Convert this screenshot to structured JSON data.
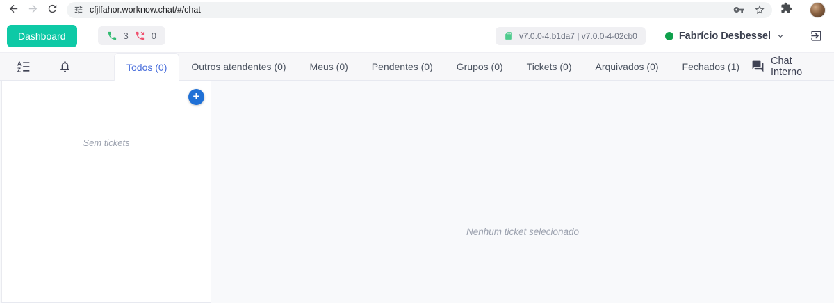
{
  "browser": {
    "url": "cfjlfahor.worknow.chat/#/chat"
  },
  "header": {
    "dashboard_button": "Dashboard",
    "calls": {
      "answered": "3",
      "missed": "0"
    },
    "version": "v7.0.0-4.b1da7 | v7.0.0-4-02cb0",
    "user": {
      "name": "Fabrício Desbessel",
      "status": "online"
    }
  },
  "tab_bar": {
    "tabs": [
      {
        "label": "Todos (0)",
        "active": true
      },
      {
        "label": "Outros atendentes (0)",
        "active": false
      },
      {
        "label": "Meus (0)",
        "active": false
      },
      {
        "label": "Pendentes (0)",
        "active": false
      },
      {
        "label": "Grupos (0)",
        "active": false
      },
      {
        "label": "Tickets (0)",
        "active": false
      },
      {
        "label": "Arquivados (0)",
        "active": false
      },
      {
        "label": "Fechados (1)",
        "active": false
      }
    ],
    "chat_interno_label": "Chat Interno"
  },
  "ticket_list": {
    "empty_message": "Sem tickets"
  },
  "ticket_view": {
    "empty_message": "Nenhum ticket selecionado"
  },
  "icons": {
    "plus": "+"
  },
  "colors": {
    "accent_teal": "#0EC9A6",
    "active_tab_blue": "#4A6FDC",
    "add_button_blue": "#1F70D6",
    "call_green": "#31BB71",
    "call_red": "#F0506E",
    "online_green": "#0FA04C"
  }
}
